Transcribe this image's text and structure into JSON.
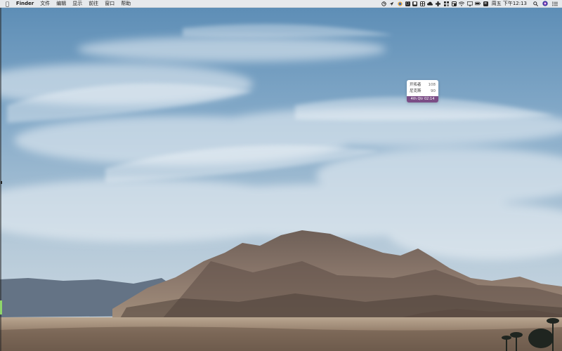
{
  "menubar": {
    "apple_icon": "apple-logo-icon",
    "app_name": "Finder",
    "menus": [
      "文件",
      "编辑",
      "显示",
      "前往",
      "窗口",
      "帮助"
    ],
    "status_icons": [
      "sync-icon",
      "location-arrow-icon",
      "colorful-app-icon",
      "keyboard-icon",
      "app-square-icon",
      "grid-app-icon",
      "cloud-icon",
      "plus-app-icon",
      "puzzle-app-icon",
      "layout-app-icon",
      "wifi-icon",
      "display-icon",
      "battery-icon",
      "input-method-icon"
    ],
    "clock": "周五 下午12:13",
    "right_icons": [
      "spotlight-search-icon",
      "siri-icon",
      "notification-center-icon"
    ]
  },
  "score_widget": {
    "rows": [
      {
        "team": "开拓者",
        "score": "108"
      },
      {
        "team": "尼克斯",
        "score": "90"
      }
    ],
    "status": "4th Qtr 02:14",
    "accent_color": "#7b4d86"
  },
  "colors": {
    "menubar_bg": "#ececee",
    "dock_hint": "#8fd66a"
  }
}
